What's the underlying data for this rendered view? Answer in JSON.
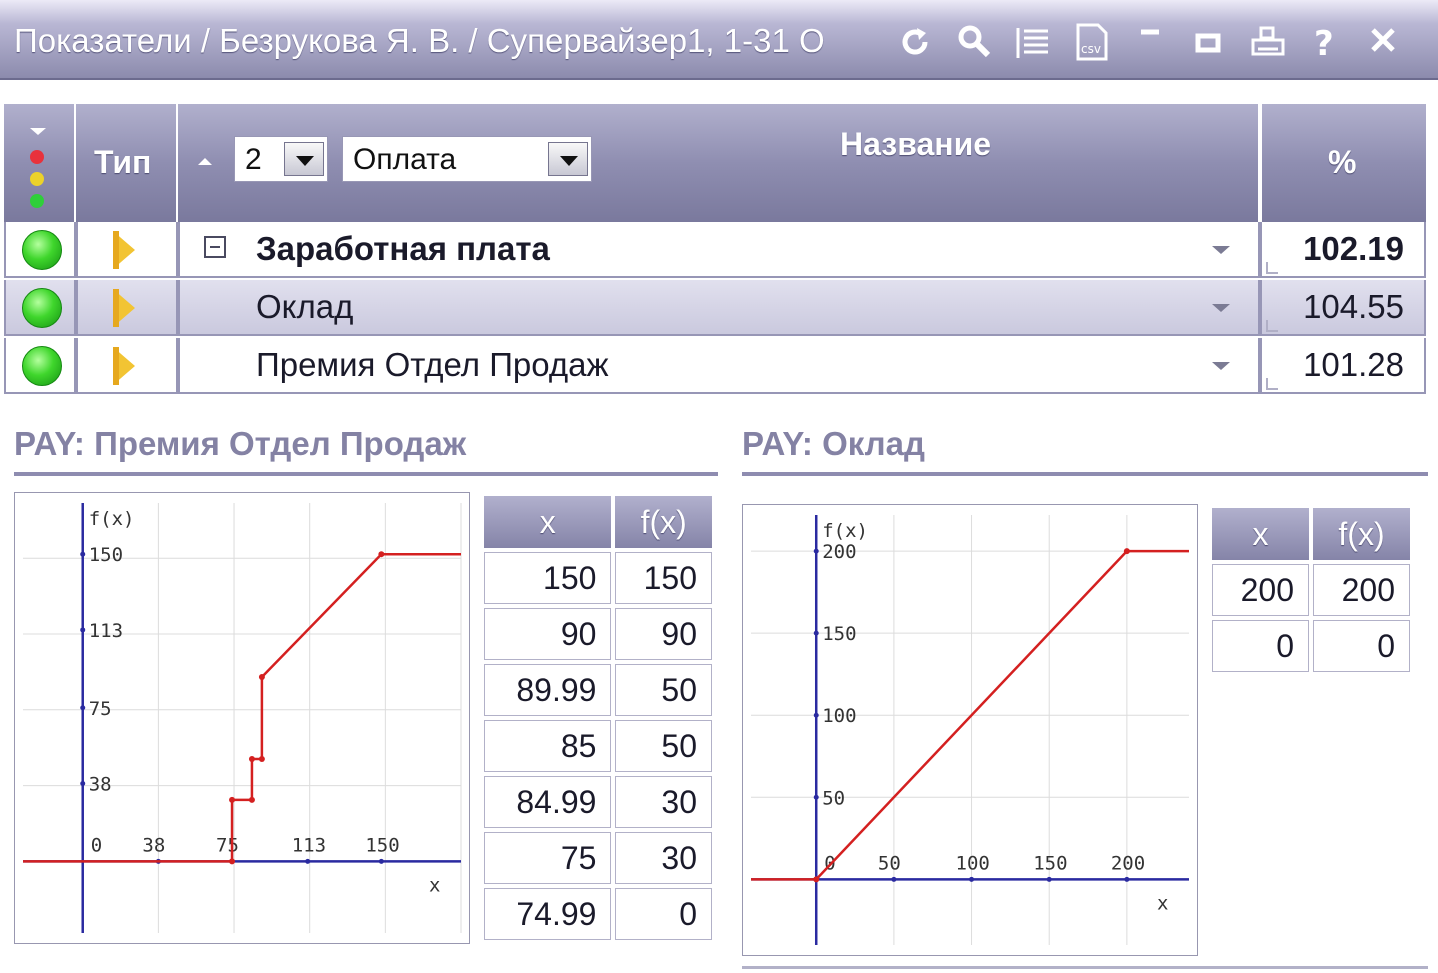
{
  "window": {
    "title": "Показатели / Безрукова Я. В. / Супервайзер1, 1-31 О",
    "toolbar_icons": [
      "refresh-icon",
      "search-icon",
      "list-icon",
      "csv-icon",
      "minimize-icon",
      "maximize-icon",
      "print-icon",
      "help-icon",
      "close-icon"
    ]
  },
  "grid": {
    "headers": {
      "type": "Тип",
      "name": "Название",
      "percent": "%"
    },
    "level_value": "2",
    "category_value": "Оплата",
    "rows": [
      {
        "name": "Заработная плата",
        "percent": "102.19",
        "bold": true,
        "status": "green"
      },
      {
        "name": "Оклад",
        "percent": "104.55",
        "bold": false,
        "status": "green"
      },
      {
        "name": "Премия Отдел Продаж",
        "percent": "101.28",
        "bold": false,
        "status": "green"
      }
    ]
  },
  "left_panel": {
    "prefix": "PAY:",
    "title": "Премия Отдел Продаж",
    "table": {
      "col_x": "x",
      "col_fx": "f(x)",
      "rows": [
        [
          "150",
          "150"
        ],
        [
          "90",
          "90"
        ],
        [
          "89.99",
          "50"
        ],
        [
          "85",
          "50"
        ],
        [
          "84.99",
          "30"
        ],
        [
          "75",
          "30"
        ],
        [
          "74.99",
          "0"
        ]
      ]
    }
  },
  "right_panel": {
    "prefix": "PAY:",
    "title": "Оклад",
    "table": {
      "col_x": "x",
      "col_fx": "f(x)",
      "rows": [
        [
          "200",
          "200"
        ],
        [
          "0",
          "0"
        ]
      ]
    }
  },
  "chart_data": [
    {
      "type": "line",
      "title": "",
      "xlabel": "x",
      "ylabel": "f(x)",
      "x_ticks": [
        "0",
        "38",
        "75",
        "113",
        "150"
      ],
      "y_ticks": [
        "38",
        "75",
        "113",
        "150"
      ],
      "xlim": [
        -30,
        190
      ],
      "ylim": [
        -35,
        175
      ],
      "series": [
        {
          "x": [
            -30,
            74.99,
            75,
            84.99,
            85,
            89.99,
            90,
            150,
            190
          ],
          "y": [
            0,
            0,
            30,
            30,
            50,
            50,
            90,
            150,
            150
          ]
        }
      ],
      "color": "#d42020",
      "grid": true
    },
    {
      "type": "line",
      "title": "",
      "xlabel": "x",
      "ylabel": "f(x)",
      "x_ticks": [
        "0",
        "50",
        "100",
        "150",
        "200"
      ],
      "y_ticks": [
        "50",
        "100",
        "150",
        "200"
      ],
      "xlim": [
        -42,
        240
      ],
      "ylim": [
        -40,
        222
      ],
      "series": [
        {
          "x": [
            -42,
            0,
            200,
            240
          ],
          "y": [
            0,
            0,
            200,
            200
          ]
        }
      ],
      "color": "#d42020",
      "grid": true
    }
  ]
}
